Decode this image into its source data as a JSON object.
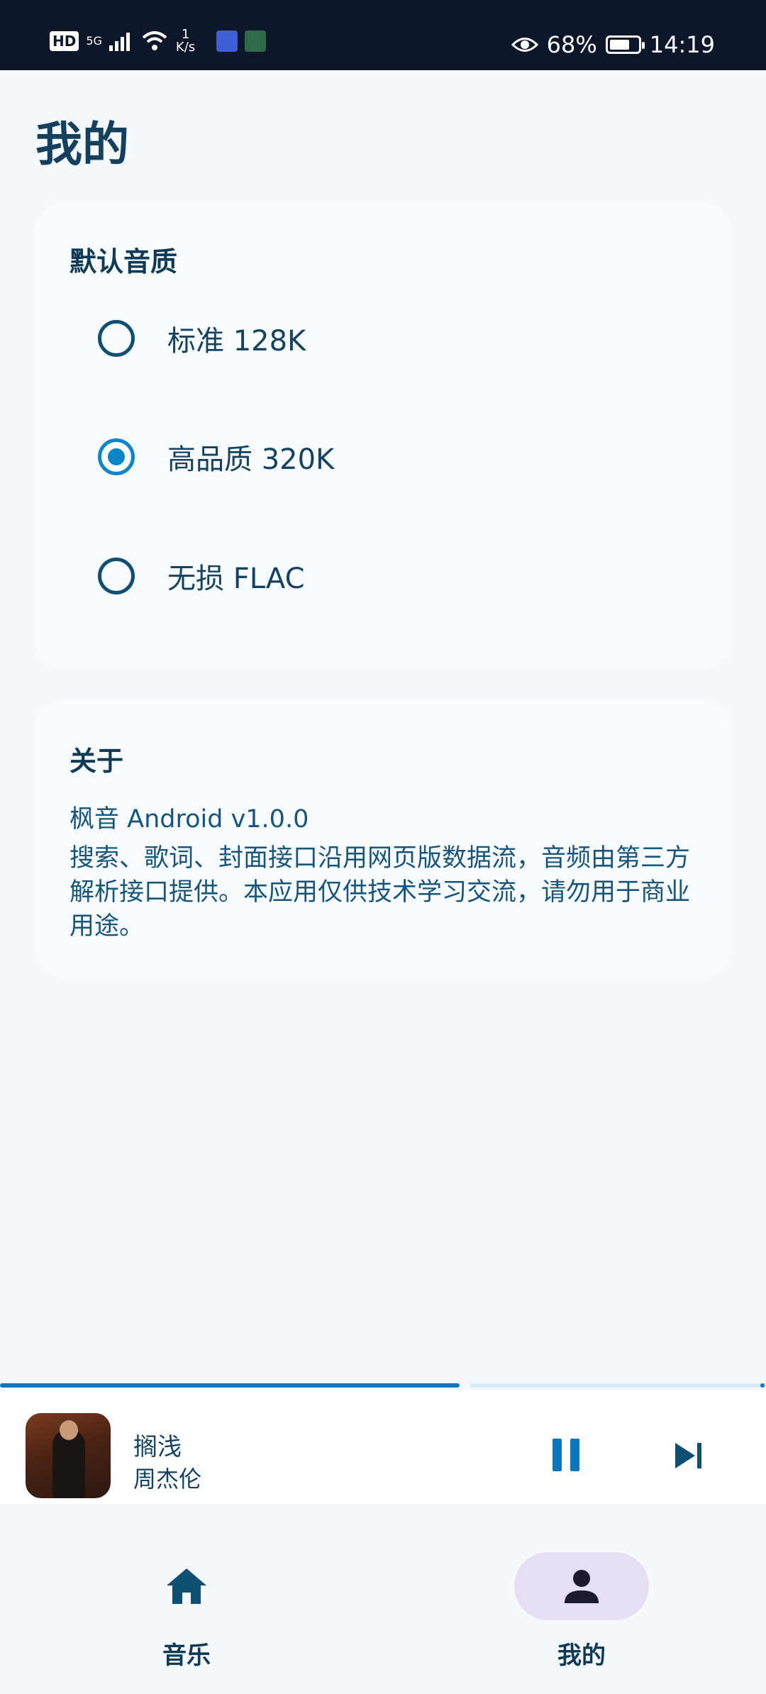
{
  "status_bar": {
    "network_hd": "HD",
    "network_gen": "5G",
    "speed_value": "1",
    "speed_unit": "K/s",
    "battery_percent": "68%",
    "time": "14:19"
  },
  "page": {
    "title": "我的"
  },
  "quality_card": {
    "title": "默认音质",
    "options": [
      {
        "label": "标准 128K",
        "selected": false
      },
      {
        "label": "高品质 320K",
        "selected": true
      },
      {
        "label": "无损 FLAC",
        "selected": false
      }
    ]
  },
  "about_card": {
    "title": "关于",
    "version": "枫音 Android v1.0.0",
    "description": "搜索、歌词、封面接口沿用网页版数据流，音频由第三方解析接口提供。本应用仅供技术学习交流，请勿用于商业用途。"
  },
  "player": {
    "progress": 0.6,
    "song_title": "搁浅",
    "artist": "周杰伦",
    "cover_icon": "album-cover"
  },
  "bottom_nav": {
    "items": [
      {
        "label": "音乐",
        "icon": "home-icon",
        "selected": false
      },
      {
        "label": "我的",
        "icon": "person-icon",
        "selected": true
      }
    ]
  },
  "colors": {
    "accent": "#0a78bf",
    "status_bar": "#0e1729",
    "background": "#f5f9fe",
    "nav_selected": "#e6def3"
  }
}
